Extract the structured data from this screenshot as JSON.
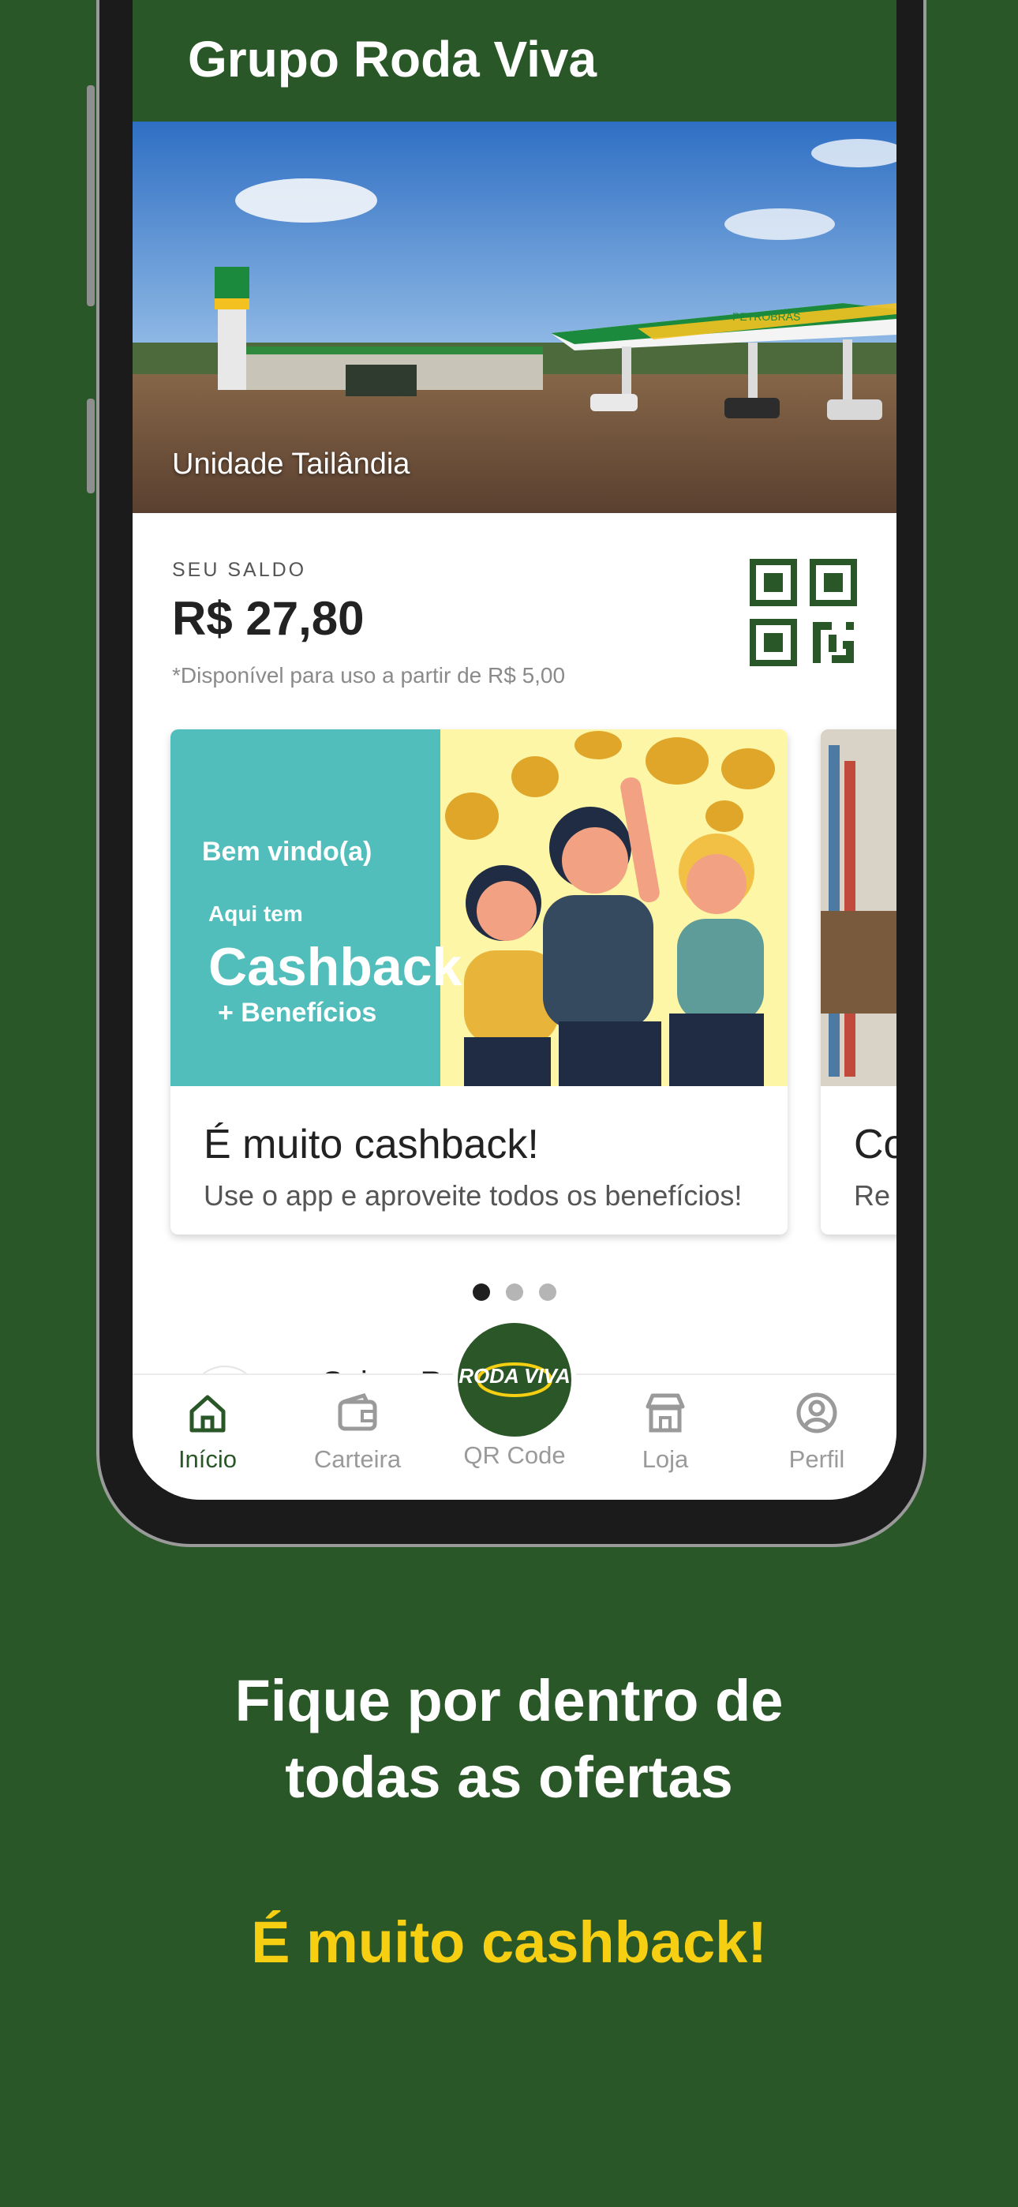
{
  "app": {
    "title": "Grupo Roda Viva"
  },
  "hero": {
    "caption": "Unidade Tailândia",
    "sign_text": "PETROBRAS"
  },
  "balance": {
    "label": "SEU SALDO",
    "value": "R$ 27,80",
    "note": "*Disponível para uso a partir de R$ 5,00",
    "qr_icon": "qr-code-icon"
  },
  "carousel": {
    "cards": [
      {
        "banner_line1": "Bem vindo(a)",
        "banner_line2": "Aqui tem",
        "banner_line3": "Cashback",
        "banner_line4": "+ Benefícios",
        "title": "É muito cashback!",
        "description": "Use o app e aproveite todos os benefícios!"
      },
      {
        "title": "Co",
        "description": "Re"
      }
    ],
    "page_count": 3,
    "active_page": 1
  },
  "list_peek": {
    "text": "Saiu o Resu"
  },
  "nav": {
    "items": [
      {
        "label": "Início",
        "icon": "home-icon",
        "active": true
      },
      {
        "label": "Carteira",
        "icon": "wallet-icon",
        "active": false
      },
      {
        "label": "QR Code",
        "icon": "roda-viva-logo",
        "active": false
      },
      {
        "label": "Loja",
        "icon": "store-icon",
        "active": false
      },
      {
        "label": "Perfil",
        "icon": "profile-icon",
        "active": false
      }
    ],
    "fab_logo_text": "RODA VIVA"
  },
  "promo": {
    "line1": "Fique por dentro de",
    "line2": "todas as ofertas",
    "tagline": "É muito cashback!"
  },
  "colors": {
    "brand_green": "#2a5727",
    "accent_yellow": "#f6cf12",
    "banner_teal": "#52bebc"
  }
}
